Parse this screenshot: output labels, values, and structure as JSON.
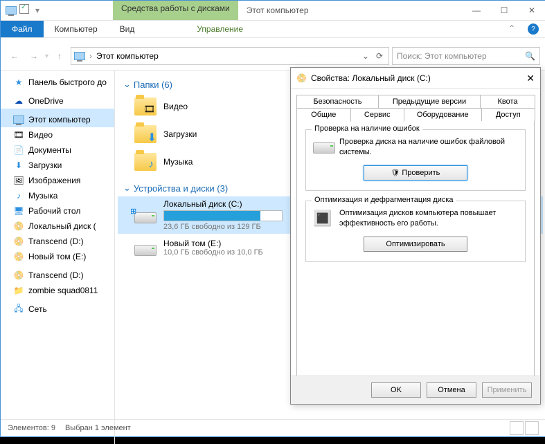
{
  "titlebar": {
    "tool_tab": "Средства работы с дисками",
    "title": "Этот компьютер"
  },
  "ribbon": {
    "file": "Файл",
    "computer": "Компьютер",
    "view": "Вид",
    "manage": "Управление"
  },
  "nav": {
    "location": "Этот компьютер",
    "search_placeholder": "Поиск: Этот компьютер"
  },
  "sidebar": {
    "quick": "Панель быстрого до",
    "onedrive": "OneDrive",
    "thispc": "Этот компьютер",
    "videos": "Видео",
    "documents": "Документы",
    "downloads": "Загрузки",
    "pictures": "Изображения",
    "music": "Музыка",
    "desktop": "Рабочий стол",
    "localdisk": "Локальный диск (",
    "transcend1": "Transcend (D:)",
    "newvol": "Новый том (E:)",
    "transcend2": "Transcend (D:)",
    "zombie": "zombie squad0811",
    "network": "Сеть"
  },
  "content": {
    "folders_header": "Папки (6)",
    "videos": "Видео",
    "downloads": "Загрузки",
    "music": "Музыка",
    "devices_header": "Устройства и диски (3)",
    "disk_c": {
      "name": "Локальный диск (C:)",
      "sub": "23,6 ГБ свободно из 129 ГБ",
      "fill_pct": 82
    },
    "disk_e": {
      "name": "Новый том (E:)",
      "sub": "10,0 ГБ свободно из 10,0 ГБ"
    }
  },
  "status": {
    "items": "Элементов: 9",
    "selected": "Выбран 1 элемент"
  },
  "dialog": {
    "title": "Свойства: Локальный диск (C:)",
    "tabs": {
      "security": "Безопасность",
      "prev": "Предыдущие версии",
      "quota": "Квота",
      "general": "Общие",
      "service": "Сервис",
      "hardware": "Оборудование",
      "access": "Доступ"
    },
    "check": {
      "legend": "Проверка на наличие ошибок",
      "text": "Проверка диска на наличие ошибок файловой системы.",
      "btn": "Проверить"
    },
    "opt": {
      "legend": "Оптимизация и дефрагментация диска",
      "text": "Оптимизация дисков компьютера повышает эффективность его работы.",
      "btn": "Оптимизировать"
    },
    "buttons": {
      "ok": "OK",
      "cancel": "Отмена",
      "apply": "Применить"
    }
  }
}
